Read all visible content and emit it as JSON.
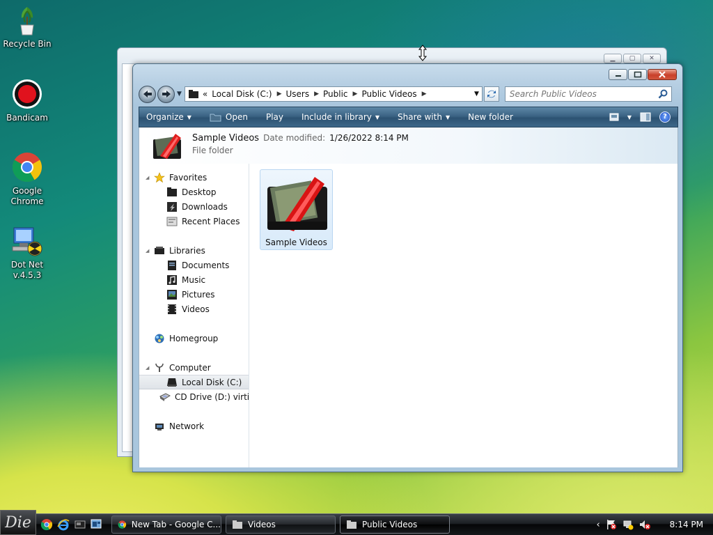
{
  "desktop": {
    "icons": [
      {
        "label": "Recycle Bin"
      },
      {
        "label": "Bandicam"
      },
      {
        "label": "Google Chrome"
      },
      {
        "label": "Dot Net v.4.5.3"
      }
    ]
  },
  "explorer": {
    "address": {
      "overflow": "«",
      "crumbs": [
        "Local Disk (C:)",
        "Users",
        "Public",
        "Public Videos"
      ]
    },
    "search_placeholder": "Search Public Videos",
    "toolbar": {
      "organize": "Organize",
      "open": "Open",
      "play": "Play",
      "include_in_library": "Include in library",
      "share_with": "Share with",
      "new_folder": "New folder"
    },
    "details": {
      "name": "Sample Videos",
      "modified_label": "Date modified:",
      "modified_value": "1/26/2022 8:14 PM",
      "type": "File folder"
    },
    "nav": {
      "favorites": "Favorites",
      "desktop": "Desktop",
      "downloads": "Downloads",
      "recent_places": "Recent Places",
      "libraries": "Libraries",
      "documents": "Documents",
      "music": "Music",
      "pictures": "Pictures",
      "videos": "Videos",
      "homegroup": "Homegroup",
      "computer": "Computer",
      "local_disk": "Local Disk (C:)",
      "cd_drive": "CD Drive (D:) virtio-w",
      "network": "Network"
    },
    "items": [
      {
        "label": "Sample Videos"
      }
    ]
  },
  "taskbar": {
    "start_label": "Die",
    "buttons": [
      {
        "label": "New Tab - Google C..."
      },
      {
        "label": "Videos"
      },
      {
        "label": "Public Videos"
      }
    ],
    "clock": "8:14 PM"
  }
}
